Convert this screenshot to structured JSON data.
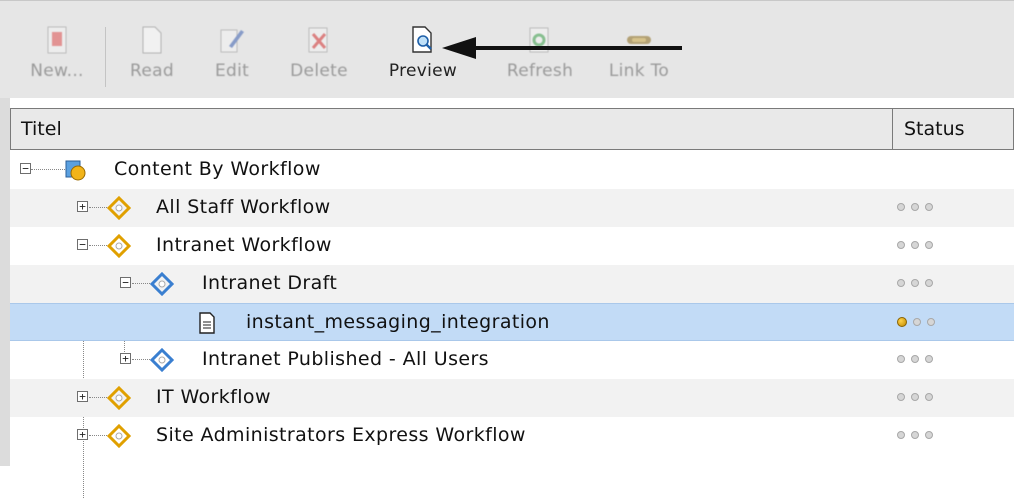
{
  "toolbar": {
    "buttons": [
      {
        "label": "New...",
        "icon": "new-item-icon",
        "state": "disabled"
      },
      {
        "label": "Read",
        "icon": "read-document-icon",
        "state": "disabled"
      },
      {
        "label": "Edit",
        "icon": "edit-pen-icon",
        "state": "disabled"
      },
      {
        "label": "Delete",
        "icon": "delete-icon",
        "state": "disabled"
      },
      {
        "label": "Preview",
        "icon": "preview-magnifier-icon",
        "state": "enabled"
      },
      {
        "label": "Refresh",
        "icon": "refresh-icon",
        "state": "disabled"
      },
      {
        "label": "Link To",
        "icon": "link-icon",
        "state": "disabled"
      }
    ]
  },
  "grid": {
    "columns": {
      "title": "Titel",
      "status": "Status"
    },
    "rows": [
      {
        "label": "Content By Workflow",
        "icon": "workflow-root-icon",
        "toggle": "−",
        "status": null
      },
      {
        "label": "All Staff Workflow",
        "icon": "workflow-icon",
        "toggle": "+",
        "status": [
          "off",
          "off",
          "off"
        ]
      },
      {
        "label": "Intranet Workflow",
        "icon": "workflow-icon",
        "toggle": "−",
        "status": [
          "off",
          "off",
          "off"
        ]
      },
      {
        "label": "Intranet Draft",
        "icon": "workflow-state-icon",
        "toggle": "−",
        "status": [
          "off",
          "off",
          "off"
        ]
      },
      {
        "label": "instant_messaging_integration",
        "icon": "document-icon",
        "toggle": null,
        "status": [
          "on",
          "off",
          "off"
        ],
        "selected": true
      },
      {
        "label": "Intranet Published - All Users",
        "icon": "workflow-state-icon",
        "toggle": "+",
        "status": [
          "off",
          "off",
          "off"
        ]
      },
      {
        "label": "IT Workflow",
        "icon": "workflow-icon",
        "toggle": "+",
        "status": [
          "off",
          "off",
          "off"
        ]
      },
      {
        "label": "Site Administrators Express Workflow",
        "icon": "workflow-icon",
        "toggle": "+",
        "status": [
          "off",
          "off",
          "off"
        ]
      }
    ]
  },
  "colors": {
    "selection": "#c2dbf6",
    "status_on": "#e0a800",
    "toolbar_bg": "#e6e6e6"
  }
}
